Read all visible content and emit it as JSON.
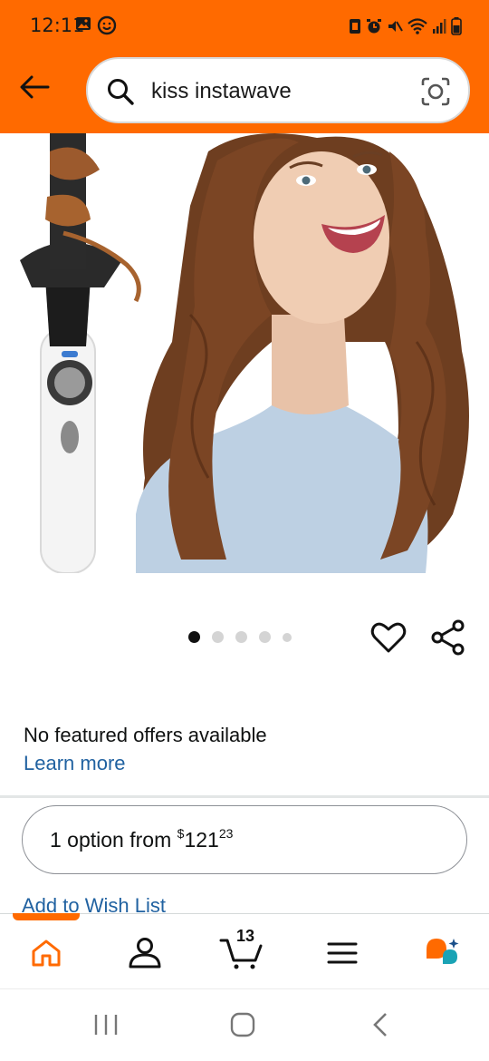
{
  "status_bar": {
    "time": "12:11"
  },
  "header": {
    "search_query": "kiss instawave",
    "icons": [
      "back-arrow-icon",
      "search-icon",
      "camera-lens-icon"
    ]
  },
  "product": {
    "image_alt": "",
    "carousel": {
      "count": 5,
      "active": 1
    }
  },
  "offers": {
    "message": "No featured offers available",
    "learn_more": "Learn more",
    "option_prefix": "1 option from ",
    "price_symbol": "$",
    "price_whole": "121",
    "price_fraction": "23",
    "wish_list": "Add to Wish List"
  },
  "bottom_nav": {
    "cart_count": "13",
    "items": [
      "home-icon",
      "account-icon",
      "cart-icon",
      "menu-icon",
      "rufus-icon"
    ]
  },
  "colors": {
    "brand": "#ff6a00",
    "link": "#2162a1"
  }
}
